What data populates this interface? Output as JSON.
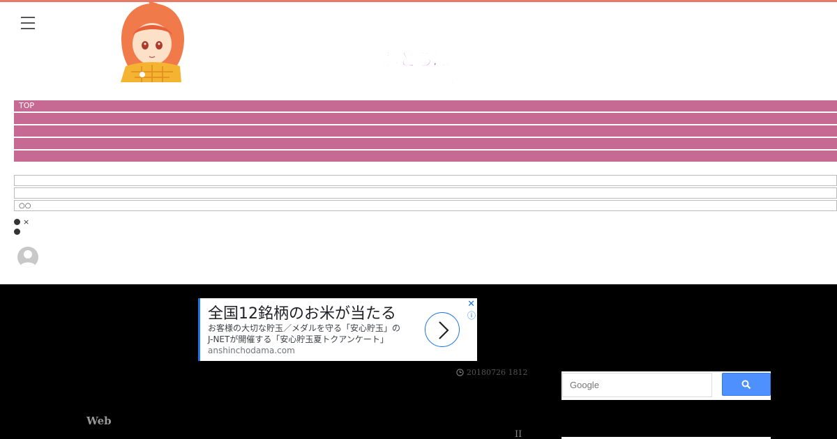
{
  "colors": {
    "top_strip": "#e87a6a",
    "nav_bg": "#c76a93",
    "dark_bg": "#000000",
    "search_button": "#4d90fe"
  },
  "header": {
    "menu_icon": "hamburger-icon",
    "logo_text_top": "ねとらぼ",
    "logo_text_bottom": "エンタ"
  },
  "nav": {
    "items": [
      "TOP",
      "",
      "",
      "",
      ""
    ]
  },
  "boxes": {
    "items": [
      "",
      "",
      "○○"
    ]
  },
  "bullets": {
    "items": [
      "×",
      ""
    ]
  },
  "ad": {
    "headline": "全国12銘柄のお米が当たる",
    "body_line1": "お客様の大切な貯玉／メダルを守る「安心貯玉」の",
    "body_line2": "J-NETが開催する「安心貯玉夏トクアンケート」",
    "url": "anshinchodama.com",
    "close": "✕",
    "info": "ⓘ"
  },
  "article": {
    "timestamp": "20180726 1812",
    "section_label": "Web",
    "mark": "II"
  },
  "search": {
    "placeholder": "Google"
  }
}
